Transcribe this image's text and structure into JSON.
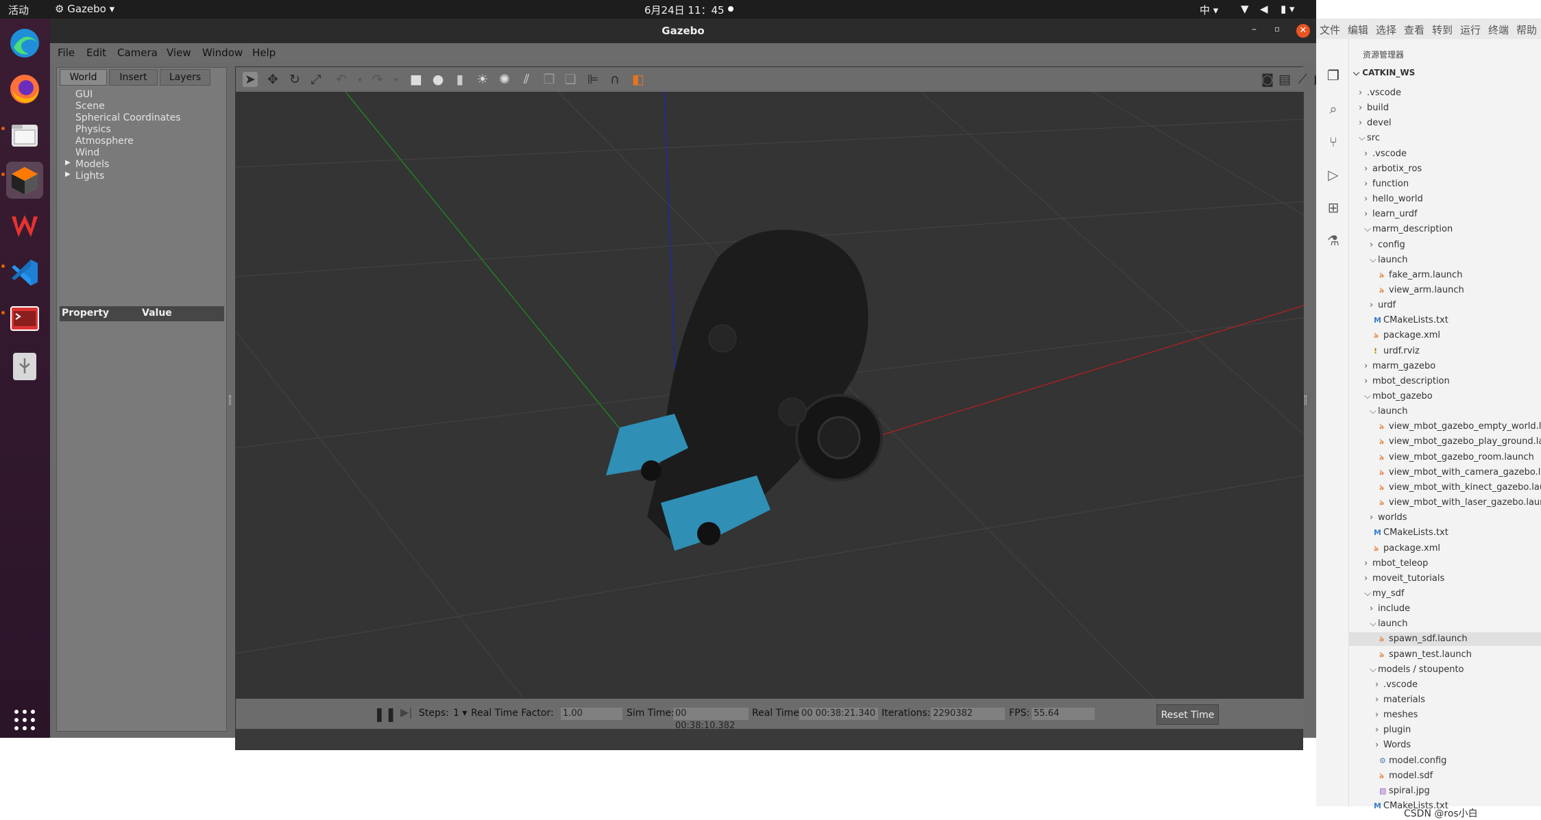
{
  "topbar": {
    "activities": "活动",
    "app": "Gazebo",
    "clock": "6月24日 11：45",
    "ime": "中"
  },
  "dock": {
    "items": [
      "edge-icon",
      "firefox-icon",
      "files-icon",
      "gazebo-icon",
      "wps-icon",
      "vscode-icon",
      "terminal-icon",
      "usb-icon",
      "app-grid-icon"
    ]
  },
  "gazebo": {
    "title": "Gazebo",
    "menu": [
      "File",
      "Edit",
      "Camera",
      "View",
      "Window",
      "Help"
    ],
    "tabs": [
      "World",
      "Insert",
      "Layers"
    ],
    "tree": [
      "GUI",
      "Scene",
      "Spherical Coordinates",
      "Physics",
      "Atmosphere",
      "Wind",
      "Models",
      "Lights"
    ],
    "property_header": {
      "property": "Property",
      "value": "Value"
    },
    "simbar": {
      "steps_label": "Steps:",
      "steps_value": "1",
      "rtf_label": "Real Time Factor:",
      "rtf_value": "1.00",
      "sim_label": "Sim Time:",
      "sim_value": "00 00:38:10.382",
      "real_label": "Real Time:",
      "real_value": "00 00:38:21.340",
      "iter_label": "Iterations:",
      "iter_value": "2290382",
      "fps_label": "FPS:",
      "fps_value": "55.64",
      "reset": "Reset Time"
    }
  },
  "vscode": {
    "menu": [
      "文件",
      "编辑",
      "选择",
      "查看",
      "转到",
      "运行",
      "终端",
      "帮助"
    ],
    "explorer_title": "资源管理器",
    "workspace": "CATKIN_WS",
    "tree": [
      {
        "label": ".vscode",
        "kind": "dir-closed"
      },
      {
        "label": "build",
        "kind": "dir-closed"
      },
      {
        "label": "devel",
        "kind": "dir-closed"
      },
      {
        "label": "src",
        "kind": "dir-open"
      },
      {
        "label": ".vscode",
        "kind": "dir-closed"
      },
      {
        "label": "arbotix_ros",
        "kind": "dir-closed"
      },
      {
        "label": "function",
        "kind": "dir-closed"
      },
      {
        "label": "hello_world",
        "kind": "dir-closed"
      },
      {
        "label": "learn_urdf",
        "kind": "dir-closed"
      },
      {
        "label": "marm_description",
        "kind": "dir-open"
      },
      {
        "label": "config",
        "kind": "dir-closed"
      },
      {
        "label": "launch",
        "kind": "dir-open"
      },
      {
        "label": "fake_arm.launch",
        "kind": "rss"
      },
      {
        "label": "view_arm.launch",
        "kind": "rss"
      },
      {
        "label": "urdf",
        "kind": "dir-closed"
      },
      {
        "label": "CMakeLists.txt",
        "kind": "cmake"
      },
      {
        "label": "package.xml",
        "kind": "rss"
      },
      {
        "label": "urdf.rviz",
        "kind": "bang"
      },
      {
        "label": "marm_gazebo",
        "kind": "dir-closed"
      },
      {
        "label": "mbot_description",
        "kind": "dir-closed"
      },
      {
        "label": "mbot_gazebo",
        "kind": "dir-open"
      },
      {
        "label": "launch",
        "kind": "dir-open"
      },
      {
        "label": "view_mbot_gazebo_empty_world.launch",
        "kind": "rss"
      },
      {
        "label": "view_mbot_gazebo_play_ground.launch",
        "kind": "rss"
      },
      {
        "label": "view_mbot_gazebo_room.launch",
        "kind": "rss"
      },
      {
        "label": "view_mbot_with_camera_gazebo.launch",
        "kind": "rss"
      },
      {
        "label": "view_mbot_with_kinect_gazebo.launch",
        "kind": "rss"
      },
      {
        "label": "view_mbot_with_laser_gazebo.launch",
        "kind": "rss"
      },
      {
        "label": "worlds",
        "kind": "dir-closed"
      },
      {
        "label": "CMakeLists.txt",
        "kind": "cmake"
      },
      {
        "label": "package.xml",
        "kind": "rss"
      },
      {
        "label": "mbot_teleop",
        "kind": "dir-closed"
      },
      {
        "label": "moveit_tutorials",
        "kind": "dir-closed"
      },
      {
        "label": "my_sdf",
        "kind": "dir-open"
      },
      {
        "label": "include",
        "kind": "dir-closed"
      },
      {
        "label": "launch",
        "kind": "dir-open"
      },
      {
        "label": "spawn_sdf.launch",
        "kind": "rss"
      },
      {
        "label": "spawn_test.launch",
        "kind": "rss"
      },
      {
        "label": "models / stoupento",
        "kind": "dir-open"
      },
      {
        "label": ".vscode",
        "kind": "dir-closed"
      },
      {
        "label": "materials",
        "kind": "dir-closed"
      },
      {
        "label": "meshes",
        "kind": "dir-closed"
      },
      {
        "label": "plugin",
        "kind": "dir-closed"
      },
      {
        "label": "Words",
        "kind": "dir-closed"
      },
      {
        "label": "model.config",
        "kind": "gear"
      },
      {
        "label": "model.sdf",
        "kind": "rss"
      },
      {
        "label": "spiral.jpg",
        "kind": "img"
      },
      {
        "label": "CMakeLists.txt",
        "kind": "cmake"
      }
    ],
    "watermark": "CSDN @ros小白"
  }
}
